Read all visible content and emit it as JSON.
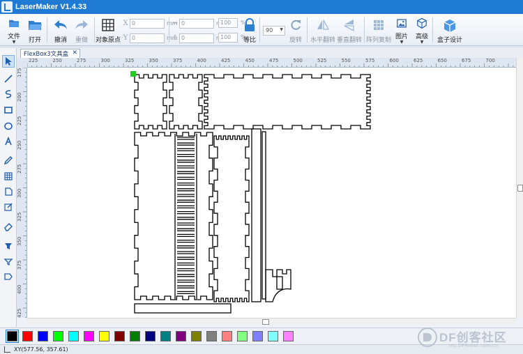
{
  "window": {
    "title": "LaserMaker V1.4.33"
  },
  "toolbar": {
    "file": "文件",
    "open": "打开",
    "undo": "撤消",
    "redo": "重做",
    "origin": "对象原点",
    "x_label": "X",
    "y_label": "Y",
    "x_value": "0",
    "y_value": "0",
    "w_value": "0",
    "h_value": "0",
    "unit_mm": "mm",
    "w_pct": "100",
    "h_pct": "100",
    "pct_unit": "%",
    "ratio": "等比",
    "angle": "90",
    "rotate": "旋转",
    "hflip": "水平翻转",
    "vflip": "垂直翻转",
    "array": "阵列复制",
    "image": "图片",
    "advanced": "高级",
    "boxdesign": "盒子设计"
  },
  "tabs": [
    {
      "label": "FlexBox3文具盒"
    }
  ],
  "ruler": {
    "h_ticks": [
      "225",
      "250",
      "275",
      "300",
      "325",
      "350",
      "375",
      "400",
      "425",
      "450",
      "475",
      "500",
      "525",
      "550",
      "575",
      "600",
      "625",
      "650",
      "675",
      "700"
    ],
    "v_ticks": [
      "175",
      "200",
      "225",
      "250",
      "275",
      "300",
      "325",
      "350",
      "375",
      "400",
      "425"
    ]
  },
  "palette": [
    "#000000",
    "#ff0000",
    "#0000ff",
    "#00ff00",
    "#00ffff",
    "#ff00ff",
    "#ffff00",
    "#800000",
    "#008000",
    "#000080",
    "#008080",
    "#800080",
    "#808000",
    "#808080",
    "#ff8080",
    "#80ff80",
    "#8080ff",
    "#80ffff",
    "#ff80ff"
  ],
  "status": {
    "coords": "XY(577.56, 357.61)"
  },
  "watermark": {
    "text": "DF创客社区",
    "sub": "mc.DFRobot.com.cn"
  }
}
